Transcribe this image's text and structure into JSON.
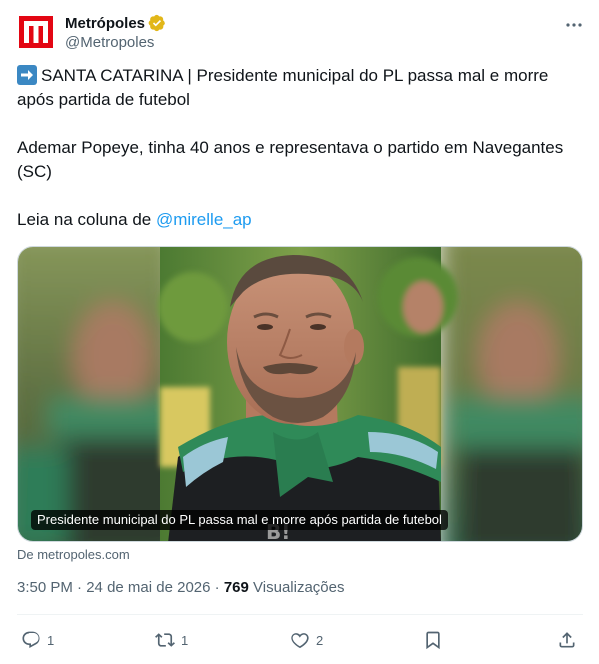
{
  "author": {
    "display_name": "Metrópoles",
    "handle": "@Metropoles",
    "logo_letter": "M",
    "brand_color": "#e30613",
    "verified_color": "#e2b719"
  },
  "tweet": {
    "line1_text": "SANTA CATARINA | Presidente municipal do PL passa mal e morre após partida de futebol",
    "line2_text": "Ademar Popeye, tinha 40 anos e representava o partido em Navegantes (SC)",
    "line3_prefix": "Leia na coluna de ",
    "line3_mention": "@mirelle_ap",
    "emoji_name": "right-arrow-emoji"
  },
  "media": {
    "caption": "Presidente municipal do PL passa mal e morre após partida de futebol",
    "source": "De metropoles.com"
  },
  "meta": {
    "time": "3:50 PM",
    "separator": " · ",
    "date": "24 de mai de 2026",
    "views_count": "769",
    "views_label": "Visualizações"
  },
  "actions": {
    "replies": "1",
    "reposts": "1",
    "likes": "2"
  },
  "colors": {
    "text": "#0f1419",
    "secondary": "#536471",
    "link": "#1d9bf0",
    "divider": "#eff3f4"
  }
}
